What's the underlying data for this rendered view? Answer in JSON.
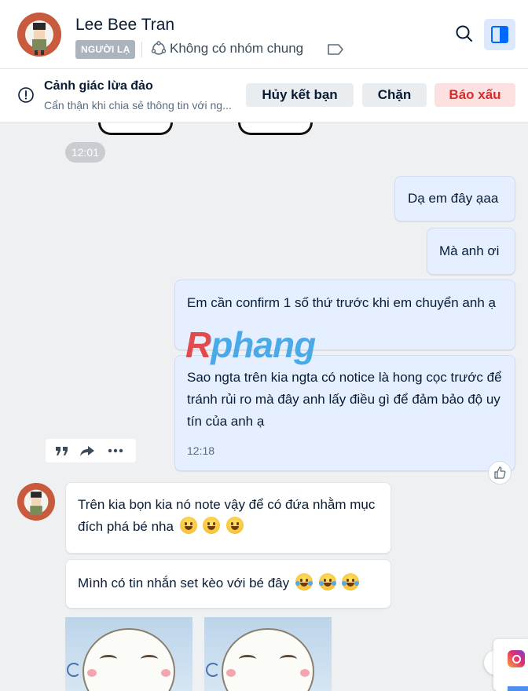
{
  "header": {
    "contact_name": "Lee Bee Tran",
    "badge": "NGƯỜI LẠ",
    "group_status": "Không có nhóm chung"
  },
  "warning": {
    "title": "Cảnh giác lừa đảo",
    "subtitle": "Cẩn thận khi chia sẻ thông tin với ng...",
    "unfriend_label": "Hủy kết bạn",
    "block_label": "Chặn",
    "report_label": "Báo xấu"
  },
  "chat": {
    "time_divider": "12:01",
    "sent": [
      {
        "text": "Dạ em đây ạaa"
      },
      {
        "text": "Mà anh ơi"
      },
      {
        "text": "Em cần confirm 1 số thứ trước khi em chuyển anh ạ"
      },
      {
        "text": "Sao ngta trên kia ngta có notice là hong cọc trước để tránh rủi ro mà đây anh lấy điều gì để đảm bảo độ uy tín của anh ạ",
        "time": "12:18"
      }
    ],
    "received": [
      {
        "text": "Trên kia bọn kia nó note vậy để có đứa nhằm mục đích phá bé nha"
      },
      {
        "text": "Mình có tin nhắn set kèo với bé đây"
      }
    ]
  },
  "watermark": "Rphang",
  "colors": {
    "sent_bubble": "#e5efff",
    "received_bubble": "#ffffff",
    "report_red": "#d92c2c",
    "accent_blue": "#0068ff"
  }
}
